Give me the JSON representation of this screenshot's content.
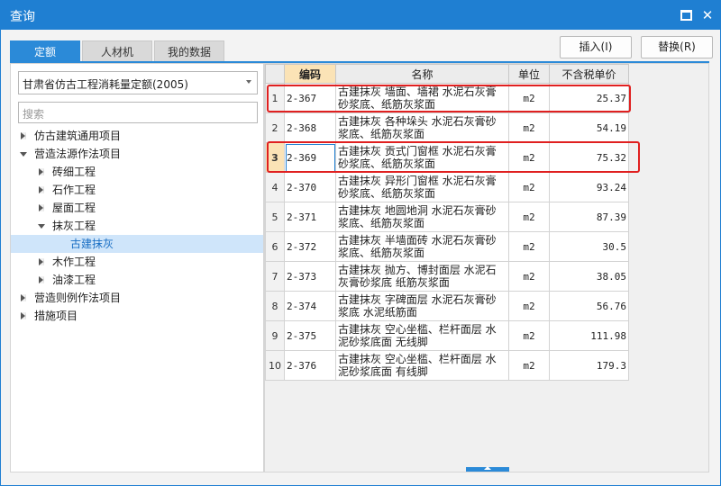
{
  "window": {
    "title": "查询"
  },
  "tabs": [
    {
      "label": "定额",
      "active": true
    },
    {
      "label": "人材机",
      "active": false
    },
    {
      "label": "我的数据",
      "active": false
    }
  ],
  "toolbar": {
    "insert_label": "插入(I)",
    "replace_label": "替换(R)"
  },
  "left": {
    "library": "甘肃省仿古工程消耗量定额(2005)",
    "search_placeholder": "搜索",
    "tree": [
      {
        "label": "仿古建筑通用项目",
        "level": 0,
        "state": "collapsed"
      },
      {
        "label": "营造法源作法项目",
        "level": 0,
        "state": "expanded"
      },
      {
        "label": "砖细工程",
        "level": 1,
        "state": "collapsed"
      },
      {
        "label": "石作工程",
        "level": 1,
        "state": "collapsed"
      },
      {
        "label": "屋面工程",
        "level": 1,
        "state": "collapsed"
      },
      {
        "label": "抹灰工程",
        "level": 1,
        "state": "expanded"
      },
      {
        "label": "古建抹灰",
        "level": 2,
        "state": "leaf",
        "selected": true
      },
      {
        "label": "木作工程",
        "level": 1,
        "state": "collapsed"
      },
      {
        "label": "油漆工程",
        "level": 1,
        "state": "collapsed"
      },
      {
        "label": "营造则例作法项目",
        "level": 0,
        "state": "collapsed"
      },
      {
        "label": "措施项目",
        "level": 0,
        "state": "collapsed"
      }
    ]
  },
  "table": {
    "headers": [
      "编码",
      "名称",
      "单位",
      "不含税单价"
    ],
    "rows": [
      {
        "n": "1",
        "code": "2-367",
        "name": "古建抹灰 墙面、墙裙 水泥石灰膏砂浆底、纸筋灰浆面",
        "unit": "m2",
        "price": "25.37"
      },
      {
        "n": "2",
        "code": "2-368",
        "name": "古建抹灰 各种垛头 水泥石灰膏砂浆底、纸筋灰浆面",
        "unit": "m2",
        "price": "54.19"
      },
      {
        "n": "3",
        "code": "2-369",
        "name": "古建抹灰 贡式门窗框 水泥石灰膏砂浆底、纸筋灰浆面",
        "unit": "m2",
        "price": "75.32"
      },
      {
        "n": "4",
        "code": "2-370",
        "name": "古建抹灰 异形门窗框 水泥石灰膏砂浆底、纸筋灰浆面",
        "unit": "m2",
        "price": "93.24"
      },
      {
        "n": "5",
        "code": "2-371",
        "name": "古建抹灰 地圆地洞 水泥石灰膏砂浆底、纸筋灰浆面",
        "unit": "m2",
        "price": "87.39"
      },
      {
        "n": "6",
        "code": "2-372",
        "name": "古建抹灰 半墙面砖 水泥石灰膏砂浆底、纸筋灰浆面",
        "unit": "m2",
        "price": "30.5"
      },
      {
        "n": "7",
        "code": "2-373",
        "name": "古建抹灰 抛方、博封面层 水泥石灰膏砂浆底 纸筋灰浆面",
        "unit": "m2",
        "price": "38.05"
      },
      {
        "n": "8",
        "code": "2-374",
        "name": "古建抹灰 字碑面层 水泥石灰膏砂浆底 水泥纸筋面",
        "unit": "m2",
        "price": "56.76"
      },
      {
        "n": "9",
        "code": "2-375",
        "name": "古建抹灰 空心坐槛、栏杆面层 水泥砂浆底面 无线脚",
        "unit": "m2",
        "price": "111.98"
      },
      {
        "n": "10",
        "code": "2-376",
        "name": "古建抹灰 空心坐槛、栏杆面层 水泥砂浆底面 有线脚",
        "unit": "m2",
        "price": "179.3"
      }
    ]
  },
  "colors": {
    "accent": "#1f7fd2",
    "highlight": "#e02020",
    "sorted_header": "#fbe3b6",
    "selected_node": "#cfe5fa"
  }
}
